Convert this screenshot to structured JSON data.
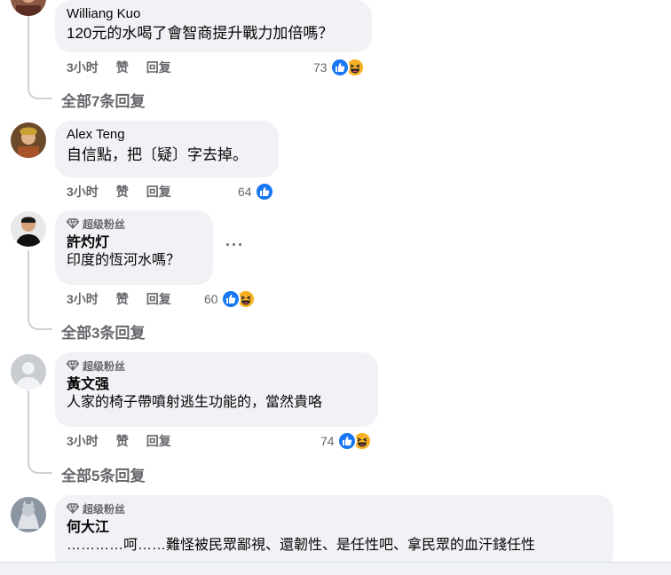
{
  "comments": [
    {
      "author": "Williang Kuo",
      "text": "120元的水喝了會智商提升戰力加倍嗎？",
      "time": "3小时",
      "like": "赞",
      "reply": "回复",
      "reaction_count": "73",
      "replies_link": "全部7条回复"
    },
    {
      "author": "Alex Teng",
      "text": "自信點，把〔疑〕字去掉。",
      "time": "3小时",
      "like": "赞",
      "reply": "回复",
      "reaction_count": "64"
    },
    {
      "badge": "超级粉丝",
      "author": "許灼灯",
      "text": "印度的恆河水嗎？",
      "time": "3小时",
      "like": "赞",
      "reply": "回复",
      "reaction_count": "60",
      "more": "···",
      "replies_link": "全部3条回复"
    },
    {
      "badge": "超级粉丝",
      "author": "黃文强",
      "text": "人家的椅子帶噴射逃生功能的，當然貴咯",
      "time": "3小时",
      "like": "赞",
      "reply": "回复",
      "reaction_count": "74",
      "replies_link": "全部5条回复"
    },
    {
      "badge": "超级粉丝",
      "author": "何大江",
      "text": "…………呵……難怪被民眾鄙視、還韌性、是任性吧、拿民眾的血汗錢任性"
    }
  ],
  "colors": {
    "like_blue": "#1877f2",
    "haha_yellow": "#f7b125",
    "bubble": "#f0f2f5",
    "meta_gray": "#65676b"
  },
  "icons": {
    "badge": "diamond-icon",
    "like": "thumbs-up-icon",
    "haha": "laughing-face-icon",
    "more": "more-horizontal-icon"
  }
}
